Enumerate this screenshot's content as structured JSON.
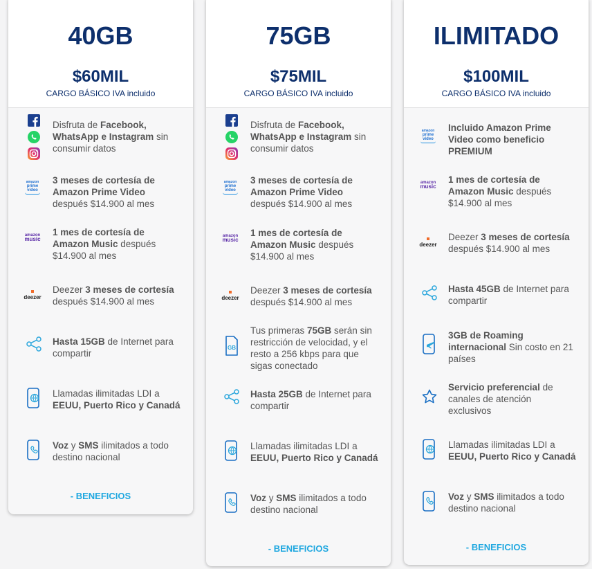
{
  "plans": [
    {
      "title": "40GB",
      "price": "$60MIL",
      "cargo": "CARGO BÁSICO IVA incluido",
      "benefits_label": "- BENEFICIOS",
      "features": [
        {
          "pre": "Disfruta de ",
          "b1": "Facebook, WhatsApp e Instagram",
          "post": " sin consumir datos"
        },
        {
          "b1": "3 meses de cortesía de Amazon Prime Video",
          "post": " después $14.900 al mes"
        },
        {
          "b1": "1 mes de cortesía de Amazon Music",
          "post": " después $14.900 al mes"
        },
        {
          "pre": "Deezer ",
          "b1": "3 meses de cortesía",
          "post": " después $14.900 al mes"
        },
        {
          "b1": "Hasta 15GB",
          "post": " de Internet para compartir"
        },
        {
          "pre": "Llamadas ilimitadas LDI a ",
          "b1": "EEUU, Puerto Rico y Canadá"
        },
        {
          "b1": "Voz",
          "mid": " y ",
          "b2": "SMS",
          "post": " ilimitados a todo destino nacional"
        }
      ]
    },
    {
      "title": "75GB",
      "price": "$75MIL",
      "cargo": "CARGO BÁSICO IVA incluido",
      "benefits_label": "- BENEFICIOS",
      "features": [
        {
          "pre": "Disfruta de ",
          "b1": "Facebook, WhatsApp e Instagram",
          "post": " sin consumir datos"
        },
        {
          "b1": "3 meses de cortesía de Amazon Prime Video",
          "post": " después $14.900 al mes"
        },
        {
          "b1": "1 mes de cortesía de Amazon Music",
          "post": " después $14.900 al mes"
        },
        {
          "pre": "Deezer ",
          "b1": "3 meses de cortesía",
          "post": " después $14.900 al mes"
        },
        {
          "pre": "Tus primeras ",
          "b1": "75GB",
          "post": " serán sin restricción de velocidad, y el resto a 256 kbps para que sigas conectado"
        },
        {
          "b1": "Hasta 25GB",
          "post": " de Internet para compartir"
        },
        {
          "pre": "Llamadas ilimitadas LDI a ",
          "b1": "EEUU, Puerto Rico y Canadá"
        },
        {
          "b1": "Voz",
          "mid": " y ",
          "b2": "SMS",
          "post": " ilimitados a todo destino nacional"
        }
      ]
    },
    {
      "title": "ILIMITADO",
      "price": "$100MIL",
      "cargo": "CARGO BÁSICO IVA incluido",
      "benefits_label": "- BENEFICIOS",
      "features": [
        {
          "b1": "Incluido Amazon Prime Video como beneficio PREMIUM"
        },
        {
          "b1": "1 mes de cortesía de Amazon Music",
          "post": " después $14.900 al mes"
        },
        {
          "pre": "Deezer ",
          "b1": "3 meses de cortesía",
          "post": " después $14.900 al mes"
        },
        {
          "b1": "Hasta 45GB",
          "post": " de Internet para compartir"
        },
        {
          "b1": "3GB de Roaming internacional",
          "post": " Sin costo en 21 países"
        },
        {
          "b1": "Servicio preferencial",
          "post": " de canales de atención exclusivos"
        },
        {
          "pre": "Llamadas ilimitadas LDI a ",
          "b1": "EEUU, Puerto Rico y Canadá"
        },
        {
          "b1": "Voz",
          "mid": " y ",
          "b2": "SMS",
          "post": " ilimitados a todo destino nacional"
        }
      ]
    }
  ],
  "icon_text": {
    "prime_small": "amazon",
    "prime_main": "prime video",
    "music_top": "amazon",
    "music_bottom": "music",
    "deezer": "deezer",
    "gb": "GB"
  },
  "colors": {
    "brand_navy": "#0d2f6c",
    "accent_cyan": "#20a8e0",
    "icon_blue": "#1a6fc4"
  }
}
